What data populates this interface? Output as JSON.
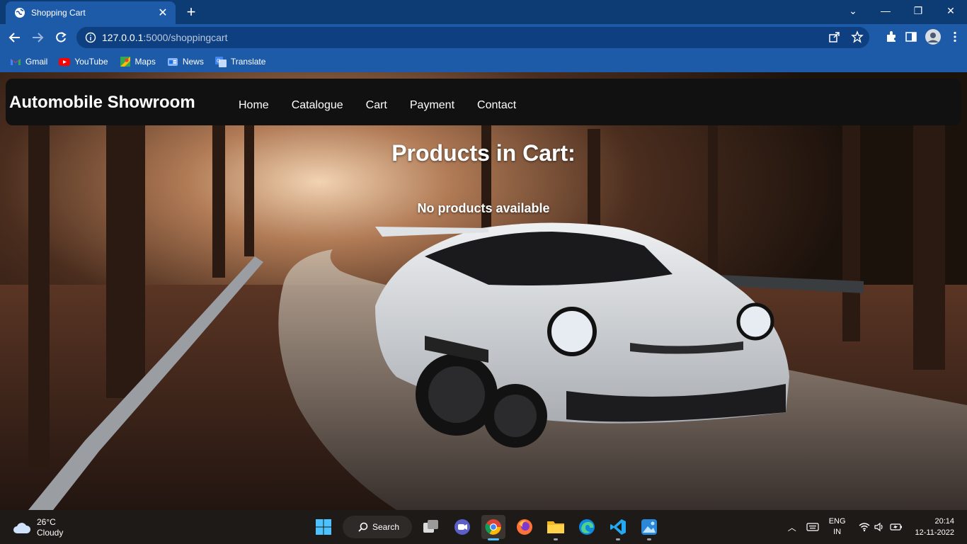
{
  "browser": {
    "tab_title": "Shopping Cart",
    "url_host": "127.0.0.1",
    "url_path": ":5000/shoppingcart",
    "bookmarks": [
      "Gmail",
      "YouTube",
      "Maps",
      "News",
      "Translate"
    ]
  },
  "site": {
    "brand": "Automobile Showroom",
    "nav": [
      "Home",
      "Catalogue",
      "Cart",
      "Payment",
      "Contact"
    ]
  },
  "cart": {
    "heading": "Products in Cart:",
    "empty_message": "No products available"
  },
  "taskbar": {
    "temperature": "26°C",
    "condition": "Cloudy",
    "search_label": "Search",
    "lang_primary": "ENG",
    "lang_secondary": "IN",
    "time": "20:14",
    "date": "12-11-2022"
  },
  "colors": {
    "chrome_dark": "#0d3b73",
    "chrome": "#1d5aa8",
    "omnibox": "#0e3f80",
    "site_nav": "#111111",
    "taskbar": "#1e1a17"
  }
}
